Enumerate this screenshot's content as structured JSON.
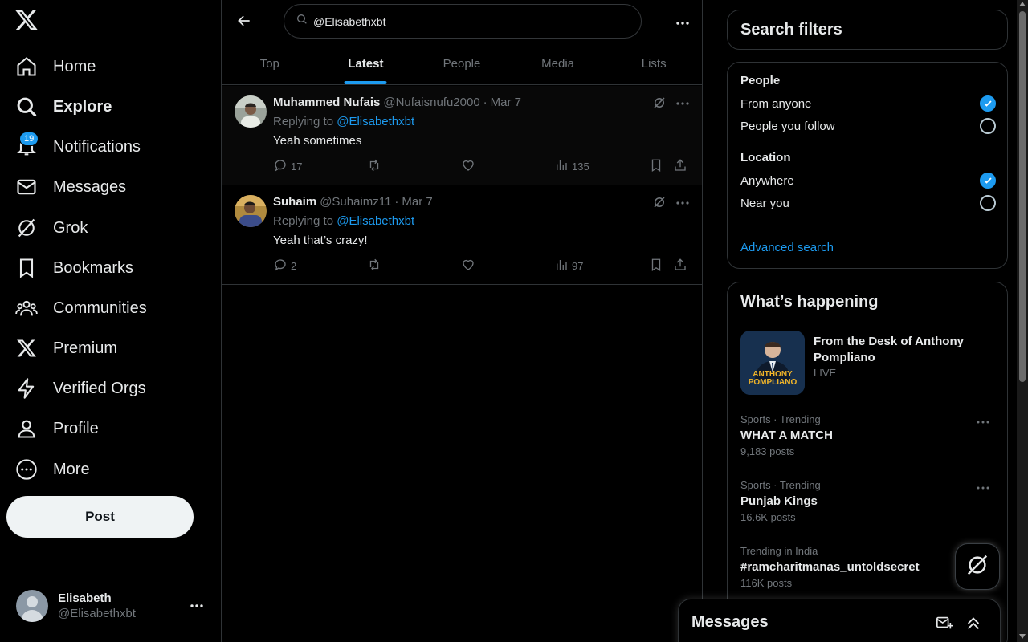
{
  "nav": {
    "items": [
      {
        "label": "Home",
        "icon": "home-icon"
      },
      {
        "label": "Explore",
        "icon": "search-icon",
        "active": true
      },
      {
        "label": "Notifications",
        "icon": "bell-icon",
        "badge": "19"
      },
      {
        "label": "Messages",
        "icon": "mail-icon"
      },
      {
        "label": "Grok",
        "icon": "grok-icon"
      },
      {
        "label": "Bookmarks",
        "icon": "bookmark-icon"
      },
      {
        "label": "Communities",
        "icon": "people-icon"
      },
      {
        "label": "Premium",
        "icon": "x-logo-icon"
      },
      {
        "label": "Verified Orgs",
        "icon": "lightning-icon"
      },
      {
        "label": "Profile",
        "icon": "person-icon"
      },
      {
        "label": "More",
        "icon": "more-circle-icon"
      }
    ],
    "post_label": "Post"
  },
  "account": {
    "name": "Elisabeth",
    "handle": "@Elisabethxbt"
  },
  "search": {
    "value": "@Elisabethxbt",
    "placeholder": "Search"
  },
  "tabs": [
    {
      "label": "Top"
    },
    {
      "label": "Latest",
      "active": true
    },
    {
      "label": "People"
    },
    {
      "label": "Media"
    },
    {
      "label": "Lists"
    }
  ],
  "tweets": [
    {
      "name": "Muhammed Nufais",
      "handle": "@Nufaisnufu2000",
      "dot": "·",
      "date": "Mar 7",
      "replying_prefix": "Replying to",
      "replying_to": "@Elisabethxbt",
      "text": "Yeah sometimes",
      "replies": "17",
      "views": "135"
    },
    {
      "name": "Suhaim",
      "handle": "@Suhaimz11",
      "dot": "·",
      "date": "Mar 7",
      "replying_prefix": "Replying to",
      "replying_to": "@Elisabethxbt",
      "text": "Yeah that’s crazy!",
      "replies": "2",
      "views": "97"
    }
  ],
  "filters": {
    "title": "Search filters",
    "people_heading": "People",
    "people_options": [
      {
        "label": "From anyone",
        "checked": true
      },
      {
        "label": "People you follow",
        "checked": false
      }
    ],
    "location_heading": "Location",
    "location_options": [
      {
        "label": "Anywhere",
        "checked": true
      },
      {
        "label": "Near you",
        "checked": false
      }
    ],
    "advanced_link": "Advanced search"
  },
  "happening": {
    "title": "What’s happening",
    "live": {
      "title": "From the Desk of Anthony Pompliano",
      "status": "LIVE",
      "image_text_1": "ANTHONY",
      "image_text_2": "POMPLIANO"
    },
    "trends": [
      {
        "meta": "Sports · Trending",
        "name": "WHAT A MATCH",
        "count": "9,183 posts"
      },
      {
        "meta": "Sports · Trending",
        "name": "Punjab Kings",
        "count": "16.6K posts"
      },
      {
        "meta": "Trending in India",
        "name": "#ramcharitmanas_untoldsecret",
        "count": "116K posts"
      }
    ]
  },
  "messages_drawer": {
    "title": "Messages"
  },
  "colors": {
    "accent": "#1d9bf0",
    "background": "#000000",
    "muted": "#71767b",
    "border": "#2f3336"
  }
}
